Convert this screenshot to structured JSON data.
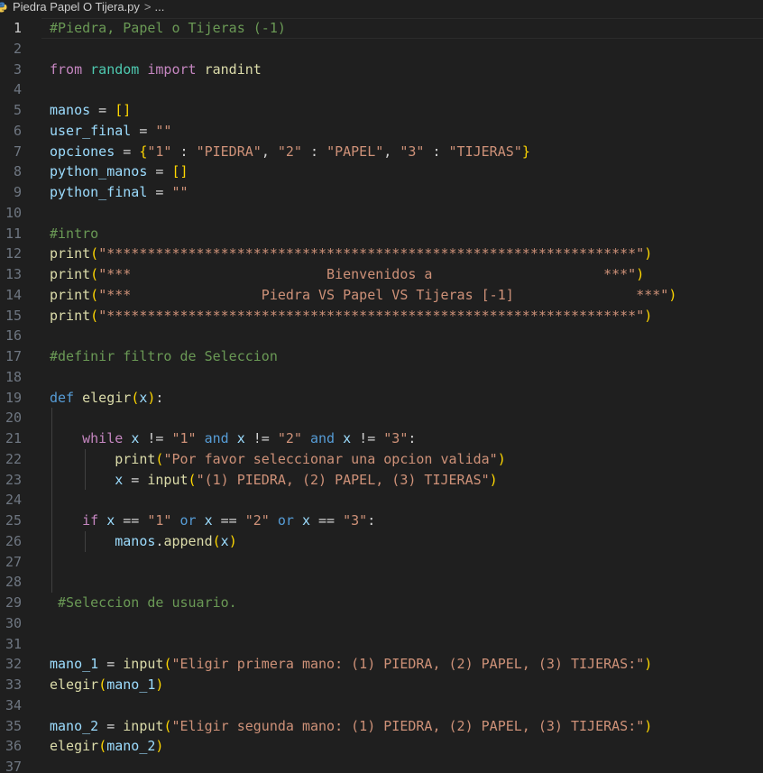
{
  "breadcrumb": {
    "file_name": "Piedra Papel O Tijera.py",
    "separator": ">",
    "more": "..."
  },
  "icons": {
    "file_icon": "python-file-icon"
  },
  "active_line": 1,
  "lines": [
    {
      "n": "1",
      "tokens": [
        {
          "c": "com",
          "t": "#Piedra, Papel o Tijeras (-1)"
        }
      ]
    },
    {
      "n": "2",
      "tokens": []
    },
    {
      "n": "3",
      "tokens": [
        {
          "c": "kwc",
          "t": "from"
        },
        {
          "c": "op",
          "t": " "
        },
        {
          "c": "mod",
          "t": "random"
        },
        {
          "c": "op",
          "t": " "
        },
        {
          "c": "kwc",
          "t": "import"
        },
        {
          "c": "op",
          "t": " "
        },
        {
          "c": "fn",
          "t": "randint"
        }
      ]
    },
    {
      "n": "4",
      "tokens": []
    },
    {
      "n": "5",
      "tokens": [
        {
          "c": "var",
          "t": "manos"
        },
        {
          "c": "op",
          "t": " = "
        },
        {
          "c": "br1",
          "t": "[]"
        }
      ]
    },
    {
      "n": "6",
      "tokens": [
        {
          "c": "var",
          "t": "user_final"
        },
        {
          "c": "op",
          "t": " = "
        },
        {
          "c": "str",
          "t": "\"\""
        }
      ]
    },
    {
      "n": "7",
      "tokens": [
        {
          "c": "var",
          "t": "opciones"
        },
        {
          "c": "op",
          "t": " = "
        },
        {
          "c": "br1",
          "t": "{"
        },
        {
          "c": "str",
          "t": "\"1\""
        },
        {
          "c": "op",
          "t": " : "
        },
        {
          "c": "str",
          "t": "\"PIEDRA\""
        },
        {
          "c": "op",
          "t": ", "
        },
        {
          "c": "str",
          "t": "\"2\""
        },
        {
          "c": "op",
          "t": " : "
        },
        {
          "c": "str",
          "t": "\"PAPEL\""
        },
        {
          "c": "op",
          "t": ", "
        },
        {
          "c": "str",
          "t": "\"3\""
        },
        {
          "c": "op",
          "t": " : "
        },
        {
          "c": "str",
          "t": "\"TIJERAS\""
        },
        {
          "c": "br1",
          "t": "}"
        }
      ]
    },
    {
      "n": "8",
      "tokens": [
        {
          "c": "var",
          "t": "python_manos"
        },
        {
          "c": "op",
          "t": " = "
        },
        {
          "c": "br1",
          "t": "[]"
        }
      ]
    },
    {
      "n": "9",
      "tokens": [
        {
          "c": "var",
          "t": "python_final"
        },
        {
          "c": "op",
          "t": " = "
        },
        {
          "c": "str",
          "t": "\"\""
        }
      ]
    },
    {
      "n": "10",
      "tokens": []
    },
    {
      "n": "11",
      "tokens": [
        {
          "c": "com",
          "t": "#intro"
        }
      ]
    },
    {
      "n": "12",
      "tokens": [
        {
          "c": "fn",
          "t": "print"
        },
        {
          "c": "br1",
          "t": "("
        },
        {
          "c": "str",
          "t": "\"*****************************************************************\""
        },
        {
          "c": "br1",
          "t": ")"
        }
      ]
    },
    {
      "n": "13",
      "tokens": [
        {
          "c": "fn",
          "t": "print"
        },
        {
          "c": "br1",
          "t": "("
        },
        {
          "c": "str",
          "t": "\"***                        Bienvenidos a                     ***\""
        },
        {
          "c": "br1",
          "t": ")"
        }
      ]
    },
    {
      "n": "14",
      "tokens": [
        {
          "c": "fn",
          "t": "print"
        },
        {
          "c": "br1",
          "t": "("
        },
        {
          "c": "str",
          "t": "\"***                Piedra VS Papel VS Tijeras [-1]               ***\""
        },
        {
          "c": "br1",
          "t": ")"
        }
      ]
    },
    {
      "n": "15",
      "tokens": [
        {
          "c": "fn",
          "t": "print"
        },
        {
          "c": "br1",
          "t": "("
        },
        {
          "c": "str",
          "t": "\"*****************************************************************\""
        },
        {
          "c": "br1",
          "t": ")"
        }
      ]
    },
    {
      "n": "16",
      "tokens": []
    },
    {
      "n": "17",
      "tokens": [
        {
          "c": "com",
          "t": "#definir filtro de Seleccion"
        }
      ]
    },
    {
      "n": "18",
      "tokens": []
    },
    {
      "n": "19",
      "tokens": [
        {
          "c": "kw",
          "t": "def"
        },
        {
          "c": "op",
          "t": " "
        },
        {
          "c": "fn",
          "t": "elegir"
        },
        {
          "c": "br1",
          "t": "("
        },
        {
          "c": "var",
          "t": "x"
        },
        {
          "c": "br1",
          "t": ")"
        },
        {
          "c": "op",
          "t": ":"
        }
      ]
    },
    {
      "n": "20",
      "tokens": []
    },
    {
      "n": "21",
      "tokens": [
        {
          "c": "op",
          "t": "    "
        },
        {
          "c": "kwc",
          "t": "while"
        },
        {
          "c": "op",
          "t": " "
        },
        {
          "c": "var",
          "t": "x"
        },
        {
          "c": "op",
          "t": " != "
        },
        {
          "c": "str",
          "t": "\"1\""
        },
        {
          "c": "op",
          "t": " "
        },
        {
          "c": "kw",
          "t": "and"
        },
        {
          "c": "op",
          "t": " "
        },
        {
          "c": "var",
          "t": "x"
        },
        {
          "c": "op",
          "t": " != "
        },
        {
          "c": "str",
          "t": "\"2\""
        },
        {
          "c": "op",
          "t": " "
        },
        {
          "c": "kw",
          "t": "and"
        },
        {
          "c": "op",
          "t": " "
        },
        {
          "c": "var",
          "t": "x"
        },
        {
          "c": "op",
          "t": " != "
        },
        {
          "c": "str",
          "t": "\"3\""
        },
        {
          "c": "op",
          "t": ":"
        }
      ]
    },
    {
      "n": "22",
      "tokens": [
        {
          "c": "op",
          "t": "        "
        },
        {
          "c": "fn",
          "t": "print"
        },
        {
          "c": "br1",
          "t": "("
        },
        {
          "c": "str",
          "t": "\"Por favor seleccionar una opcion valida\""
        },
        {
          "c": "br1",
          "t": ")"
        }
      ]
    },
    {
      "n": "23",
      "tokens": [
        {
          "c": "op",
          "t": "        "
        },
        {
          "c": "var",
          "t": "x"
        },
        {
          "c": "op",
          "t": " = "
        },
        {
          "c": "fn",
          "t": "input"
        },
        {
          "c": "br1",
          "t": "("
        },
        {
          "c": "str",
          "t": "\"(1) PIEDRA, (2) PAPEL, (3) TIJERAS\""
        },
        {
          "c": "br1",
          "t": ")"
        }
      ]
    },
    {
      "n": "24",
      "tokens": []
    },
    {
      "n": "25",
      "tokens": [
        {
          "c": "op",
          "t": "    "
        },
        {
          "c": "kwc",
          "t": "if"
        },
        {
          "c": "op",
          "t": " "
        },
        {
          "c": "var",
          "t": "x"
        },
        {
          "c": "op",
          "t": " == "
        },
        {
          "c": "str",
          "t": "\"1\""
        },
        {
          "c": "op",
          "t": " "
        },
        {
          "c": "kw",
          "t": "or"
        },
        {
          "c": "op",
          "t": " "
        },
        {
          "c": "var",
          "t": "x"
        },
        {
          "c": "op",
          "t": " == "
        },
        {
          "c": "str",
          "t": "\"2\""
        },
        {
          "c": "op",
          "t": " "
        },
        {
          "c": "kw",
          "t": "or"
        },
        {
          "c": "op",
          "t": " "
        },
        {
          "c": "var",
          "t": "x"
        },
        {
          "c": "op",
          "t": " == "
        },
        {
          "c": "str",
          "t": "\"3\""
        },
        {
          "c": "op",
          "t": ":"
        }
      ]
    },
    {
      "n": "26",
      "tokens": [
        {
          "c": "op",
          "t": "        "
        },
        {
          "c": "var",
          "t": "manos"
        },
        {
          "c": "op",
          "t": "."
        },
        {
          "c": "fn",
          "t": "append"
        },
        {
          "c": "br1",
          "t": "("
        },
        {
          "c": "var",
          "t": "x"
        },
        {
          "c": "br1",
          "t": ")"
        }
      ]
    },
    {
      "n": "27",
      "tokens": []
    },
    {
      "n": "28",
      "tokens": []
    },
    {
      "n": "29",
      "tokens": [
        {
          "c": "op",
          "t": " "
        },
        {
          "c": "com",
          "t": "#Seleccion de usuario."
        }
      ]
    },
    {
      "n": "30",
      "tokens": []
    },
    {
      "n": "31",
      "tokens": []
    },
    {
      "n": "32",
      "tokens": [
        {
          "c": "var",
          "t": "mano_1"
        },
        {
          "c": "op",
          "t": " = "
        },
        {
          "c": "fn",
          "t": "input"
        },
        {
          "c": "br1",
          "t": "("
        },
        {
          "c": "str",
          "t": "\"Eligir primera mano: (1) PIEDRA, (2) PAPEL, (3) TIJERAS:\""
        },
        {
          "c": "br1",
          "t": ")"
        }
      ]
    },
    {
      "n": "33",
      "tokens": [
        {
          "c": "fn",
          "t": "elegir"
        },
        {
          "c": "br1",
          "t": "("
        },
        {
          "c": "var",
          "t": "mano_1"
        },
        {
          "c": "br1",
          "t": ")"
        }
      ]
    },
    {
      "n": "34",
      "tokens": []
    },
    {
      "n": "35",
      "tokens": [
        {
          "c": "var",
          "t": "mano_2"
        },
        {
          "c": "op",
          "t": " = "
        },
        {
          "c": "fn",
          "t": "input"
        },
        {
          "c": "br1",
          "t": "("
        },
        {
          "c": "str",
          "t": "\"Eligir segunda mano: (1) PIEDRA, (2) PAPEL, (3) TIJERAS:\""
        },
        {
          "c": "br1",
          "t": ")"
        }
      ]
    },
    {
      "n": "36",
      "tokens": [
        {
          "c": "fn",
          "t": "elegir"
        },
        {
          "c": "br1",
          "t": "("
        },
        {
          "c": "var",
          "t": "mano_2"
        },
        {
          "c": "br1",
          "t": ")"
        }
      ]
    },
    {
      "n": "37",
      "tokens": []
    }
  ]
}
